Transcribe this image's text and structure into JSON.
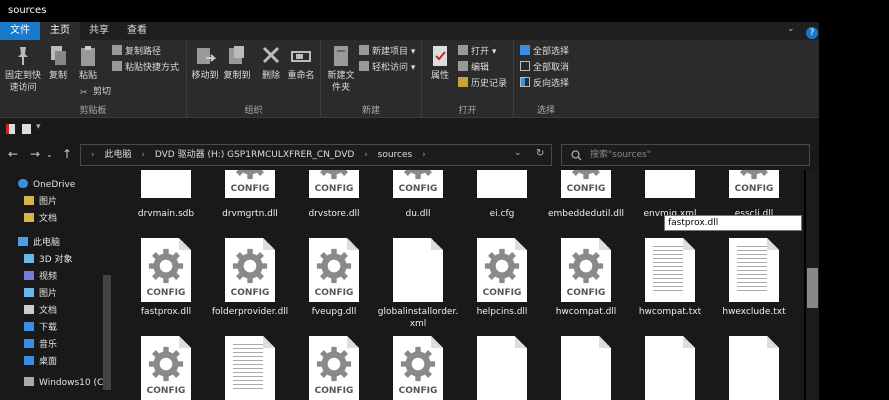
{
  "window": {
    "title": "sources"
  },
  "tabs": {
    "file": "文件",
    "home": "主页",
    "share": "共享",
    "view": "查看"
  },
  "ribbon": {
    "clipboard": {
      "label": "剪贴板",
      "pin": "固定到快速访问",
      "copy": "复制",
      "paste": "粘贴",
      "copy_path": "复制路径",
      "paste_shortcut": "粘贴快捷方式",
      "cut": "剪切"
    },
    "organize": {
      "label": "组织",
      "move_to": "移动到",
      "copy_to": "复制到",
      "delete": "删除",
      "rename": "重命名"
    },
    "new": {
      "label": "新建",
      "new_folder": "新建文件夹",
      "new_item": "新建项目",
      "easy_access": "轻松访问"
    },
    "open": {
      "label": "打开",
      "properties": "属性",
      "open": "打开",
      "edit": "编辑",
      "history": "历史记录"
    },
    "select": {
      "label": "选择",
      "select_all": "全部选择",
      "select_none": "全部取消",
      "invert": "反向选择"
    }
  },
  "address": {
    "crumbs": [
      "此电脑",
      "DVD 驱动器 (H:) GSP1RMCULXFRER_CN_DVD",
      "sources"
    ]
  },
  "search": {
    "placeholder": "搜索\"sources\""
  },
  "sidebar": {
    "items": [
      {
        "label": "OneDrive",
        "icon": "cloud-icon"
      },
      {
        "label": "图片",
        "icon": "folder-icon"
      },
      {
        "label": "文档",
        "icon": "folder-icon"
      },
      {
        "label": "此电脑",
        "icon": "computer-icon"
      },
      {
        "label": "3D 对象",
        "icon": "folder-3d-icon"
      },
      {
        "label": "视频",
        "icon": "video-folder-icon"
      },
      {
        "label": "图片",
        "icon": "pictures-folder-icon"
      },
      {
        "label": "文档",
        "icon": "documents-folder-icon"
      },
      {
        "label": "下载",
        "icon": "download-folder-icon"
      },
      {
        "label": "音乐",
        "icon": "music-folder-icon"
      },
      {
        "label": "桌面",
        "icon": "desktop-folder-icon"
      },
      {
        "label": "Windows10 (C:",
        "icon": "drive-icon"
      }
    ]
  },
  "files": {
    "row1": [
      {
        "name": "drvmain.sdb",
        "icon": "blank-file-icon"
      },
      {
        "name": "drvmgrtn.dll",
        "icon": "config-file-icon"
      },
      {
        "name": "drvstore.dll",
        "icon": "config-file-icon"
      },
      {
        "name": "du.dll",
        "icon": "config-file-icon"
      },
      {
        "name": "ei.cfg",
        "icon": "blank-file-icon"
      },
      {
        "name": "embeddedutil.dll",
        "icon": "config-file-icon"
      },
      {
        "name": "envmig.xml",
        "icon": "blank-file-icon"
      },
      {
        "name": "esscli.dll",
        "icon": "config-file-icon"
      }
    ],
    "row2": [
      {
        "name": "fastprox.dll",
        "icon": "config-file-icon"
      },
      {
        "name": "folderprovider.dll",
        "icon": "config-file-icon"
      },
      {
        "name": "fveupg.dll",
        "icon": "config-file-icon"
      },
      {
        "name": "globalinstallorder.xml",
        "icon": "blank-file-icon"
      },
      {
        "name": "helpcins.dll",
        "icon": "config-file-icon"
      },
      {
        "name": "hwcompat.dll",
        "icon": "config-file-icon"
      },
      {
        "name": "hwcompat.txt",
        "icon": "text-file-icon"
      },
      {
        "name": "hwexclude.txt",
        "icon": "text-file-icon"
      }
    ],
    "row3": [
      {
        "icon": "config-file-icon"
      },
      {
        "icon": "text-file-icon"
      },
      {
        "icon": "config-file-icon"
      },
      {
        "icon": "config-file-icon"
      },
      {
        "icon": "blank-file-icon"
      },
      {
        "icon": "blank-file-icon"
      },
      {
        "icon": "blank-file-icon"
      },
      {
        "icon": "blank-file-icon"
      }
    ],
    "config_label": "CONFIG"
  },
  "tooltip": "fastprox.dll"
}
